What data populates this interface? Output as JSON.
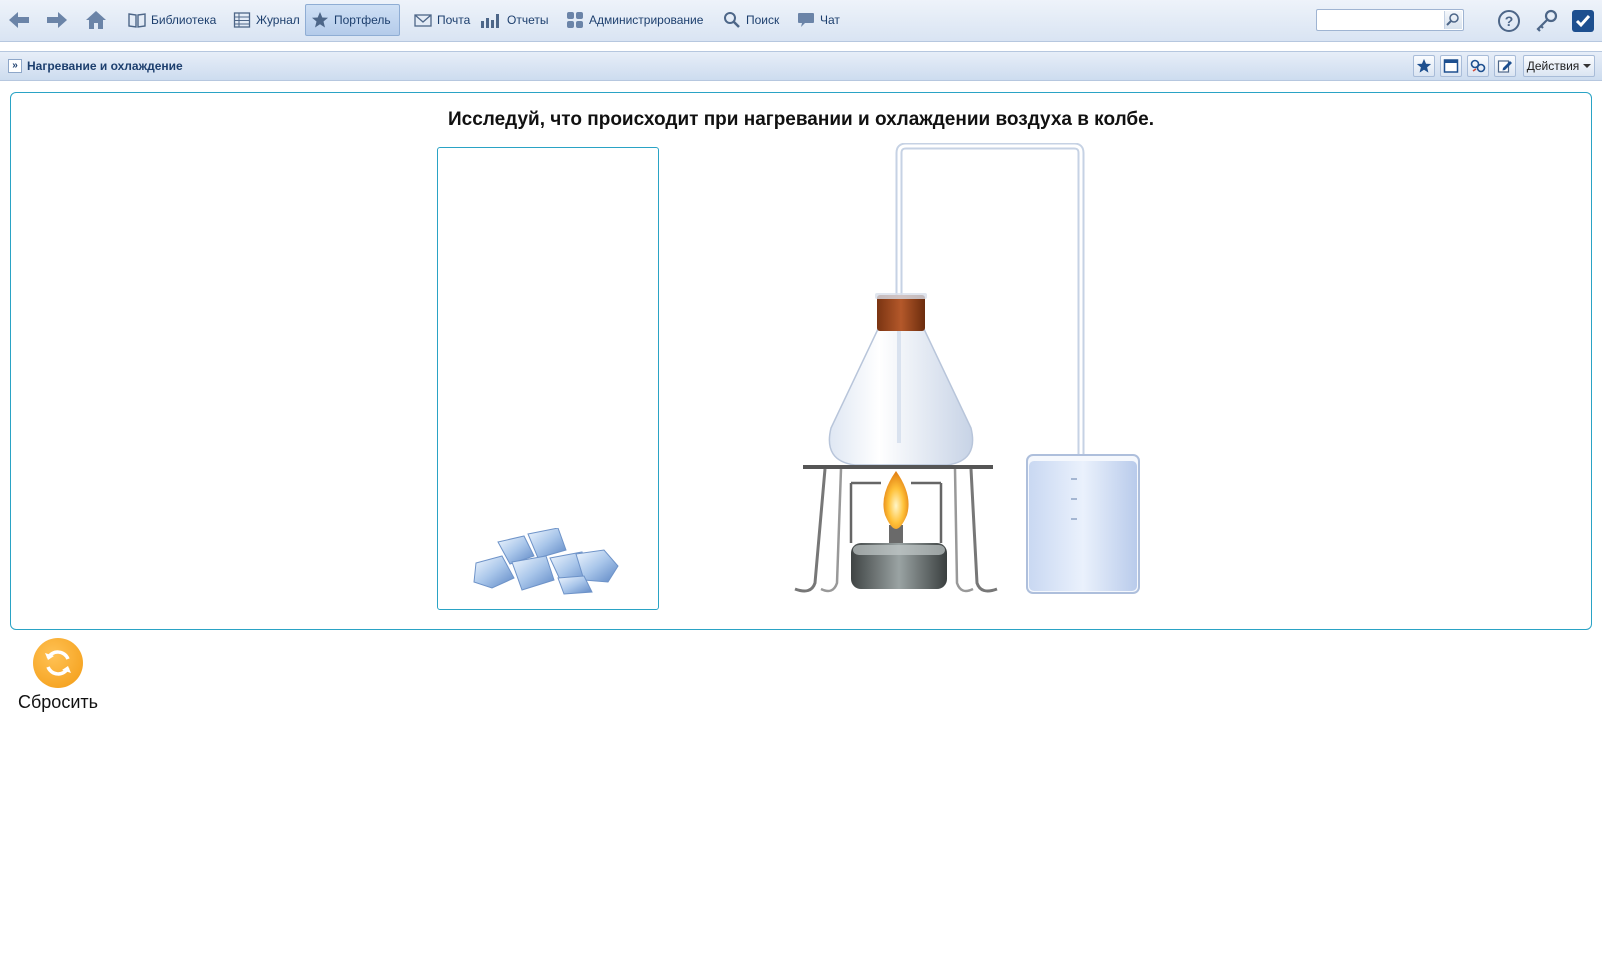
{
  "toolbar": {
    "back_icon": "arrow-left-icon",
    "forward_icon": "arrow-right-icon",
    "home_icon": "home-icon",
    "items": [
      {
        "label": "Библиотека",
        "icon": "book-icon"
      },
      {
        "label": "Журнал",
        "icon": "journal-icon"
      },
      {
        "label": "Портфель",
        "icon": "star-icon",
        "active": true
      },
      {
        "label": "Почта",
        "icon": "mail-icon"
      },
      {
        "label": "Отчеты",
        "icon": "reports-icon"
      },
      {
        "label": "Администрирование",
        "icon": "admin-icon"
      },
      {
        "label": "Поиск",
        "icon": "magnifier-icon"
      },
      {
        "label": "Чат",
        "icon": "chat-icon"
      }
    ],
    "search": {
      "value": "",
      "placeholder": ""
    },
    "right_icons": [
      "help-icon",
      "key-icon",
      "checkbox-checked-icon"
    ]
  },
  "subbar": {
    "title": "Нагревание и охлаждение",
    "buttons": [
      "favorite-star-icon",
      "window-icon",
      "link-icon",
      "edit-icon"
    ],
    "actions_label": "Действия"
  },
  "task": {
    "title": "Исследуй, что происходит при нагревании и охлаждении воздуха в колбе."
  },
  "reset": {
    "label": "Сбросить"
  },
  "colors": {
    "accent": "#2aa3c5",
    "toolbar_text": "#1d3f6e",
    "reset_orange": "#f39b13"
  }
}
